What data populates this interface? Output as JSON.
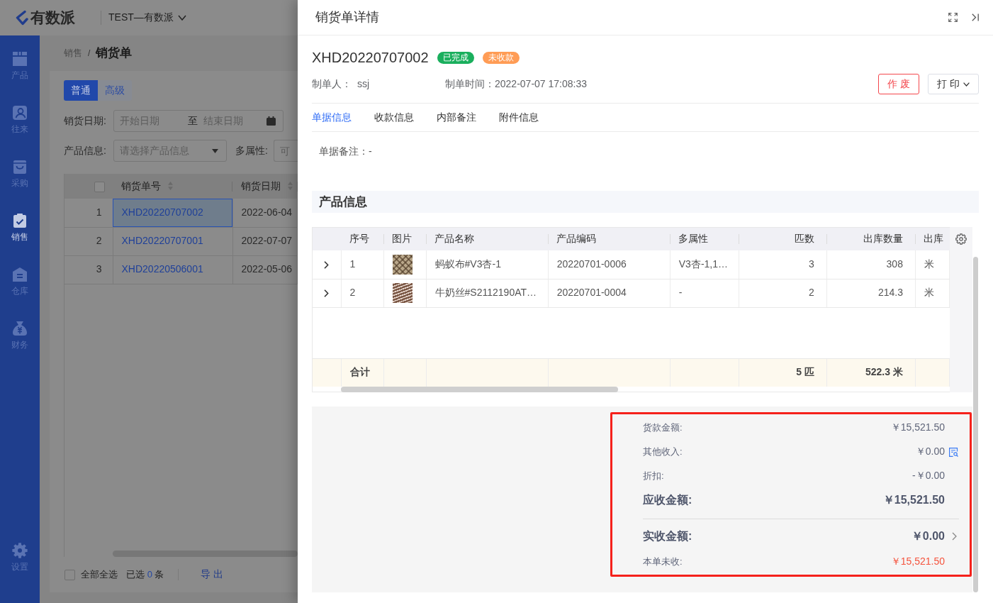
{
  "app_header": {
    "logo": "有数派",
    "company": "TEST—有数派"
  },
  "sidebar": {
    "items": [
      {
        "label": "产品",
        "selected": false
      },
      {
        "label": "往来",
        "selected": false
      },
      {
        "label": "采购",
        "selected": false
      },
      {
        "label": "销售",
        "selected": true
      },
      {
        "label": "仓库",
        "selected": false
      },
      {
        "label": "财务",
        "selected": false
      }
    ],
    "settings": {
      "label": "设置"
    }
  },
  "breadcrumb": {
    "items": [
      "销售",
      "销货单"
    ],
    "separator": "/"
  },
  "view_tabs": [
    {
      "label": "普通",
      "selected": true
    },
    {
      "label": "高级",
      "selected": false
    }
  ],
  "filter_rows": [
    [
      {
        "kind": "date_range",
        "label": "销货日期:",
        "start_placeholder": "开始日期",
        "separator": "至",
        "end_placeholder": "结束日期"
      }
    ],
    [
      {
        "kind": "select",
        "label": "产品信息:",
        "placeholder": "请选择产品信息"
      },
      {
        "kind": "input",
        "label": "多属性:",
        "placeholder": "可"
      }
    ]
  ],
  "orders_table": {
    "select_all_checked": false,
    "columns": [
      "销货单号",
      "销货日期"
    ],
    "rows": [
      {
        "index": "1",
        "number": "XHD20220707002",
        "date": "2022-06-04",
        "selected": true
      },
      {
        "index": "2",
        "number": "XHD20220707001",
        "date": "2022-07-07",
        "selected": false
      },
      {
        "index": "3",
        "number": "XHD20220506001",
        "date": "2022-05-06",
        "selected": false
      }
    ]
  },
  "list_footer": {
    "select_all": {
      "label": "全部全选",
      "checked": false
    },
    "selection": {
      "prefix": "已选",
      "count": "0",
      "suffix": "条"
    },
    "export": {
      "label": "导 出",
      "disabled": true
    }
  },
  "drawer": {
    "title": "销货单详情",
    "order_number": "XHD20220707002",
    "status_tags": [
      {
        "label": "已完成",
        "color": "#1aaf5d"
      },
      {
        "label": "未收款",
        "color": "#ff9c55"
      }
    ],
    "meta": [
      {
        "label": "制单人：",
        "value": "ssj"
      },
      {
        "label": "制单时间：",
        "value": "2022-07-07 17:08:33"
      }
    ],
    "actions": [
      {
        "kind": "danger",
        "label": "作 废"
      },
      {
        "kind": "dropdown",
        "label": "打 印"
      }
    ],
    "tabs": [
      {
        "label": "单据信息",
        "selected": true
      },
      {
        "label": "收款信息",
        "selected": false
      },
      {
        "label": "内部备注",
        "selected": false
      },
      {
        "label": "附件信息",
        "selected": false
      }
    ],
    "remark": {
      "label": "单据备注：",
      "value": "-"
    },
    "section_title": "产品信息",
    "products": {
      "columns": [
        {
          "label": "序号",
          "kind": "text"
        },
        {
          "label": "图片",
          "kind": "image"
        },
        {
          "label": "产品名称",
          "kind": "text"
        },
        {
          "label": "产品编码",
          "kind": "text"
        },
        {
          "label": "多属性",
          "kind": "text"
        },
        {
          "label": "匹数",
          "kind": "number"
        },
        {
          "label": "出库数量",
          "kind": "number"
        },
        {
          "label": "出库",
          "kind": "text"
        }
      ],
      "rows": [
        {
          "expanded": false,
          "cells": [
            "1",
            "",
            "蚂蚁布#V3杏-1",
            "20220701-0006",
            "V3杏-1,1…",
            "3",
            "308",
            "米"
          ]
        },
        {
          "expanded": false,
          "cells": [
            "2",
            "",
            "牛奶丝#S2112190AT…",
            "20220701-0004",
            "-",
            "2",
            "214.3",
            "米"
          ]
        }
      ],
      "total": {
        "cells": [
          "合计",
          "",
          "",
          "",
          "",
          "5 匹",
          "522.3 米"
        ]
      }
    },
    "summary": [
      {
        "kind": "plain",
        "label": "货款金额:",
        "value": "￥15,521.50"
      },
      {
        "kind": "detail",
        "label": "其他收入:",
        "value": "￥0.00"
      },
      {
        "kind": "plain",
        "label": "折扣:",
        "value": "-￥0.00"
      },
      {
        "kind": "total",
        "label": "应收金额:",
        "value": "￥15,521.50"
      },
      {
        "kind": "paid",
        "label": "实收金额:",
        "value": "￥0.00"
      },
      {
        "kind": "due",
        "label": "本单未收:",
        "value": "￥15,521.50"
      }
    ]
  }
}
